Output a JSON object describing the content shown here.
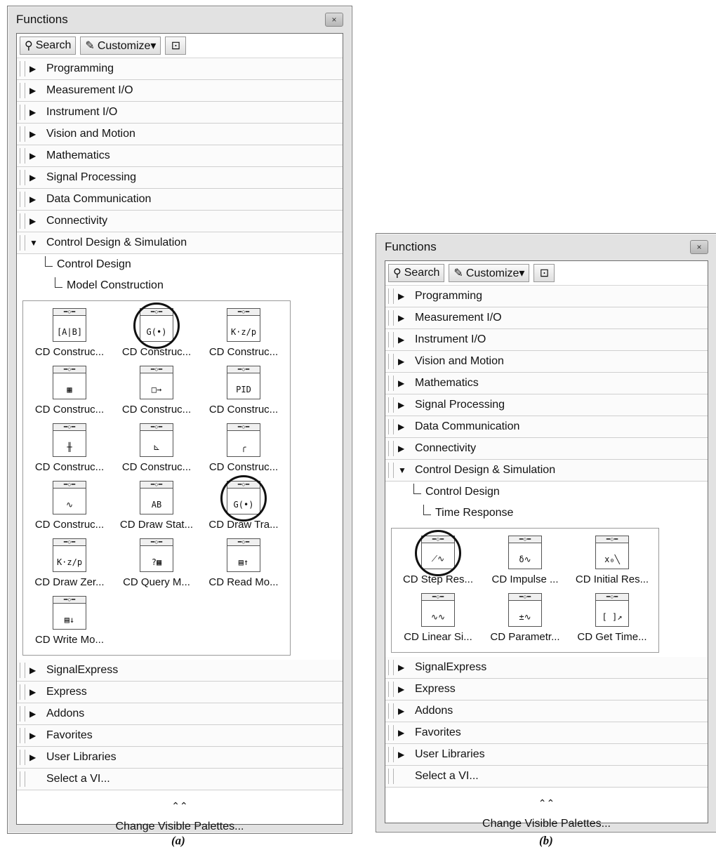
{
  "palette_a": {
    "title": "Functions",
    "close": "×",
    "toolbar": {
      "search": "Search",
      "customize": "Customize▾",
      "pin": "⊡"
    },
    "categories_top": [
      "Programming",
      "Measurement I/O",
      "Instrument I/O",
      "Vision and Motion",
      "Mathematics",
      "Signal Processing",
      "Data Communication",
      "Connectivity"
    ],
    "open_category": "Control Design & Simulation",
    "sub1": "Control Design",
    "sub2": "Model Construction",
    "icons": [
      {
        "name": "CD Construc...",
        "sym": "[A|B]"
      },
      {
        "name": "CD Construc...",
        "sym": "G(•)",
        "ring": true
      },
      {
        "name": "CD Construc...",
        "sym": "K·z/p"
      },
      {
        "name": "CD Construc...",
        "sym": "▦"
      },
      {
        "name": "CD Construc...",
        "sym": "□→"
      },
      {
        "name": "CD Construc...",
        "sym": "PID"
      },
      {
        "name": "CD Construc...",
        "sym": "╫"
      },
      {
        "name": "CD Construc...",
        "sym": "⊾"
      },
      {
        "name": "CD Construc...",
        "sym": "╭"
      },
      {
        "name": "CD Construc...",
        "sym": "∿"
      },
      {
        "name": "CD Draw Stat...",
        "sym": "AB"
      },
      {
        "name": "CD Draw Tra...",
        "sym": "G(•)",
        "ring": true
      },
      {
        "name": "CD Draw Zer...",
        "sym": "K·z/p"
      },
      {
        "name": "CD Query M...",
        "sym": "?▦"
      },
      {
        "name": "CD Read Mo...",
        "sym": "▤↑"
      },
      {
        "name": "CD Write Mo...",
        "sym": "▤↓"
      }
    ],
    "categories_bottom": [
      "SignalExpress",
      "Express",
      "Addons",
      "Favorites",
      "User Libraries"
    ],
    "select_vi": "Select a VI...",
    "expand": "⌃⌃",
    "change": "Change Visible Palettes..."
  },
  "palette_b": {
    "title": "Functions",
    "close": "×",
    "toolbar": {
      "search": "Search",
      "customize": "Customize▾",
      "pin": "⊡"
    },
    "categories_top": [
      "Programming",
      "Measurement I/O",
      "Instrument I/O",
      "Vision and Motion",
      "Mathematics",
      "Signal Processing",
      "Data Communication",
      "Connectivity"
    ],
    "open_category": "Control Design & Simulation",
    "sub1": "Control Design",
    "sub2": "Time Response",
    "icons": [
      {
        "name": "CD Step Res...",
        "sym": "⟋∿",
        "ring": true
      },
      {
        "name": "CD Impulse ...",
        "sym": "δ∿"
      },
      {
        "name": "CD Initial Res...",
        "sym": "x₀╲"
      },
      {
        "name": "CD Linear Si...",
        "sym": "∿∿"
      },
      {
        "name": "CD Parametr...",
        "sym": "±∿"
      },
      {
        "name": "CD Get Time...",
        "sym": "[ ]↗"
      }
    ],
    "categories_bottom": [
      "SignalExpress",
      "Express",
      "Addons",
      "Favorites",
      "User Libraries"
    ],
    "select_vi": "Select a VI...",
    "expand": "⌃⌃",
    "change": "Change Visible Palettes..."
  },
  "captions": {
    "a": "(a)",
    "b": "(b)"
  }
}
